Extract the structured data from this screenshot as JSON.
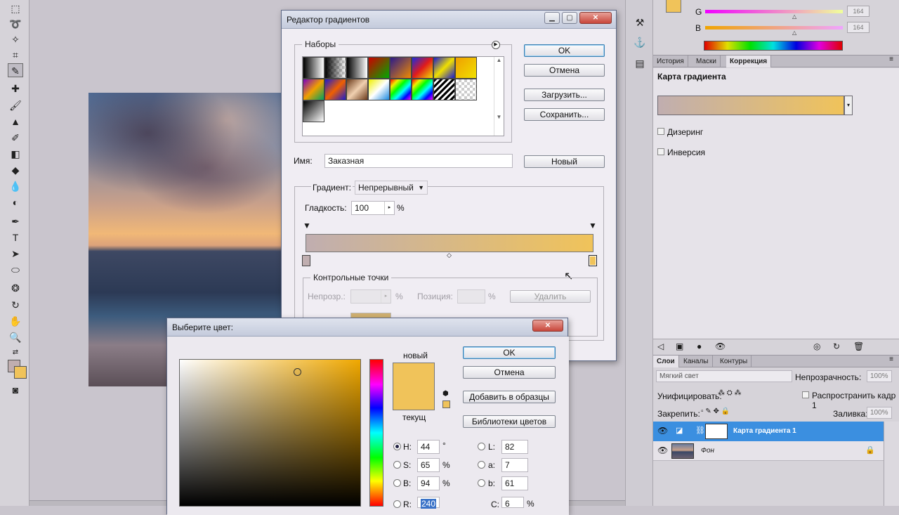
{
  "gradient_editor": {
    "title": "Редактор градиентов",
    "presets_label": "Наборы",
    "buttons": {
      "ok": "OK",
      "cancel": "Отмена",
      "load": "Загрузить...",
      "save": "Сохранить...",
      "new": "Новый"
    },
    "name_label": "Имя:",
    "name_value": "Заказная",
    "gradient_type_label": "Градиент:",
    "gradient_type_value": "Непрерывный",
    "smoothness_label": "Гладкость:",
    "smoothness_value": "100",
    "smoothness_unit": "%",
    "gradient_start_color": "#c0aeb0",
    "gradient_end_color": "#f0c35a",
    "stops_label": "Контрольные точки",
    "opacity_label": "Непрозр.:",
    "position_label": "Позиция:",
    "percent": "%",
    "delete_label": "Удалить"
  },
  "color_picker": {
    "title": "Выберите цвет:",
    "new_label": "новый",
    "current_label": "текущ",
    "new_color": "#f0c35a",
    "current_color": "#f0c35a",
    "buttons": {
      "ok": "OK",
      "cancel": "Отмена",
      "add_swatch": "Добавить в образцы",
      "libraries": "Библиотеки цветов"
    },
    "fields": {
      "H": {
        "label": "H:",
        "value": "44",
        "unit": "°"
      },
      "S": {
        "label": "S:",
        "value": "65",
        "unit": "%"
      },
      "B": {
        "label": "B:",
        "value": "94",
        "unit": "%"
      },
      "R": {
        "label": "R:",
        "value": "240"
      },
      "L": {
        "label": "L:",
        "value": "82"
      },
      "a": {
        "label": "a:",
        "value": "7"
      },
      "b": {
        "label": "b:",
        "value": "61"
      },
      "C": {
        "label": "C:",
        "value": "6",
        "unit": "%"
      }
    },
    "hue_color": "#f0a800"
  },
  "color_panel": {
    "G_label": "G",
    "G_value": "164",
    "B_label": "B",
    "B_value": "164"
  },
  "adjust_panel": {
    "tabs": [
      "История",
      "Маски",
      "Коррекция"
    ],
    "active_tab": "Коррекция",
    "title": "Карта градиента",
    "dithering_label": "Дизеринг",
    "reverse_label": "Инверсия"
  },
  "layers_panel": {
    "tabs": [
      "Слои",
      "Каналы",
      "Контуры"
    ],
    "blend_mode": "Мягкий свет",
    "opacity_label": "Непрозрачность:",
    "opacity_value": "100%",
    "unify_label": "Унифицировать:",
    "propagate_label": "Распространить кадр 1",
    "lock_label": "Закрепить:",
    "fill_label": "Заливка:",
    "fill_value": "100%",
    "layers": [
      {
        "name": "Карта градиента 1",
        "selected": true
      },
      {
        "name": "Фон",
        "selected": false
      }
    ]
  }
}
